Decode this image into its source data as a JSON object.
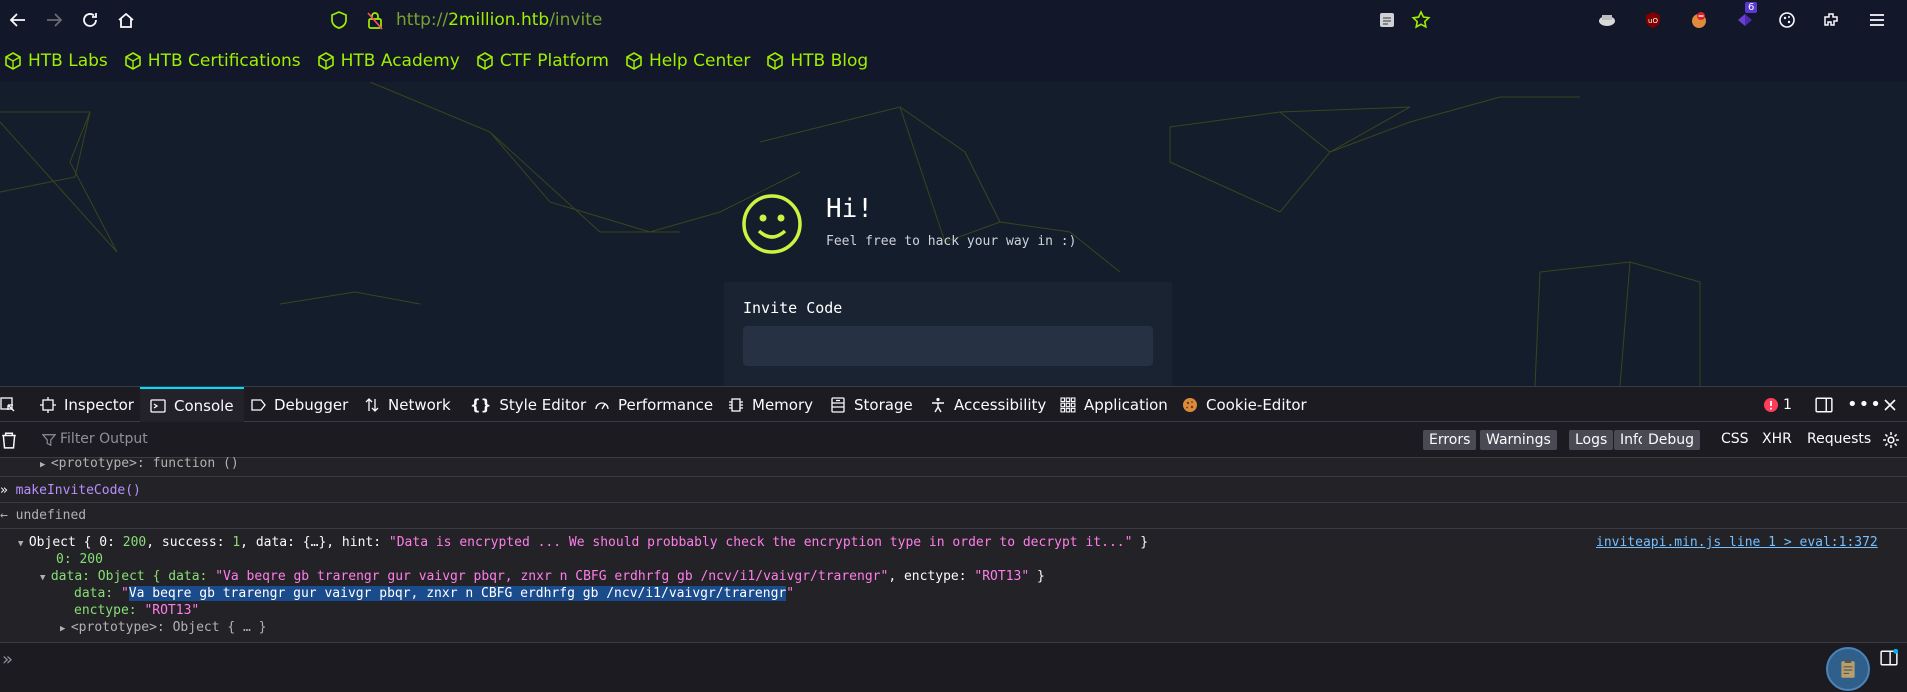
{
  "browser": {
    "url_scheme": "http://",
    "url_host": "2million.htb",
    "url_path": "/invite",
    "extension_badge": "6"
  },
  "bookmarks": [
    "HTB Labs",
    "HTB Certifications",
    "HTB Academy",
    "CTF Platform",
    "Help Center",
    "HTB Blog"
  ],
  "page": {
    "greeting": "Hi!",
    "subtitle": "Feel free to hack your way in :)",
    "invite_label": "Invite Code"
  },
  "devtools": {
    "tabs": [
      "Inspector",
      "Console",
      "Debugger",
      "Network",
      "Style Editor",
      "Performance",
      "Memory",
      "Storage",
      "Accessibility",
      "Application",
      "Cookie-Editor"
    ],
    "active_tab": "Console",
    "error_count": "1",
    "filter_placeholder": "Filter Output",
    "filter_buttons": [
      "Errors",
      "Warnings",
      "Logs",
      "Info",
      "Debug"
    ],
    "filter_text_buttons": [
      "CSS",
      "XHR",
      "Requests"
    ]
  },
  "console": {
    "proto_line": "<prototype>: function ()",
    "command": "makeInviteCode()",
    "undefined": "undefined",
    "obj_prefix": "Object { 0: ",
    "obj_200": "200",
    "obj_mid1": ", success: ",
    "obj_1": "1",
    "obj_mid2": ", data: {…}, hint: ",
    "obj_hint": "\"Data is encrypted ... We should probbably check the encryption type in order to decrypt it...\"",
    "obj_end": " }",
    "source_link": "inviteapi.min.js line 1 > eval:1:372",
    "zero_key": "0: ",
    "zero_val": "200",
    "data_prefix": "data: Object { data: ",
    "data_str": "\"Va beqre gb trarengr gur vaivgr pbqr, znxr n CBFG erdhrfg gb /ncv/i1/vaivgr/trarengr\"",
    "data_mid": ", enctype: ",
    "data_enc": "\"ROT13\"",
    "data_end": " }",
    "inner_data_key": "data: ",
    "inner_data_quote_open": "\"",
    "inner_data_val": "Va beqre gb trarengr gur vaivgr pbqr, znxr n CBFG erdhrfg gb /ncv/i1/vaivgr/trarengr",
    "inner_data_quote_close": "\"",
    "enctype_key": "enctype: ",
    "enctype_val": "\"ROT13\"",
    "proto_obj": "<prototype>: Object { … }"
  },
  "colors": {
    "accent": "#9fef00",
    "devtools_bg": "#1c1b22",
    "page_bg": "#141d2b"
  }
}
